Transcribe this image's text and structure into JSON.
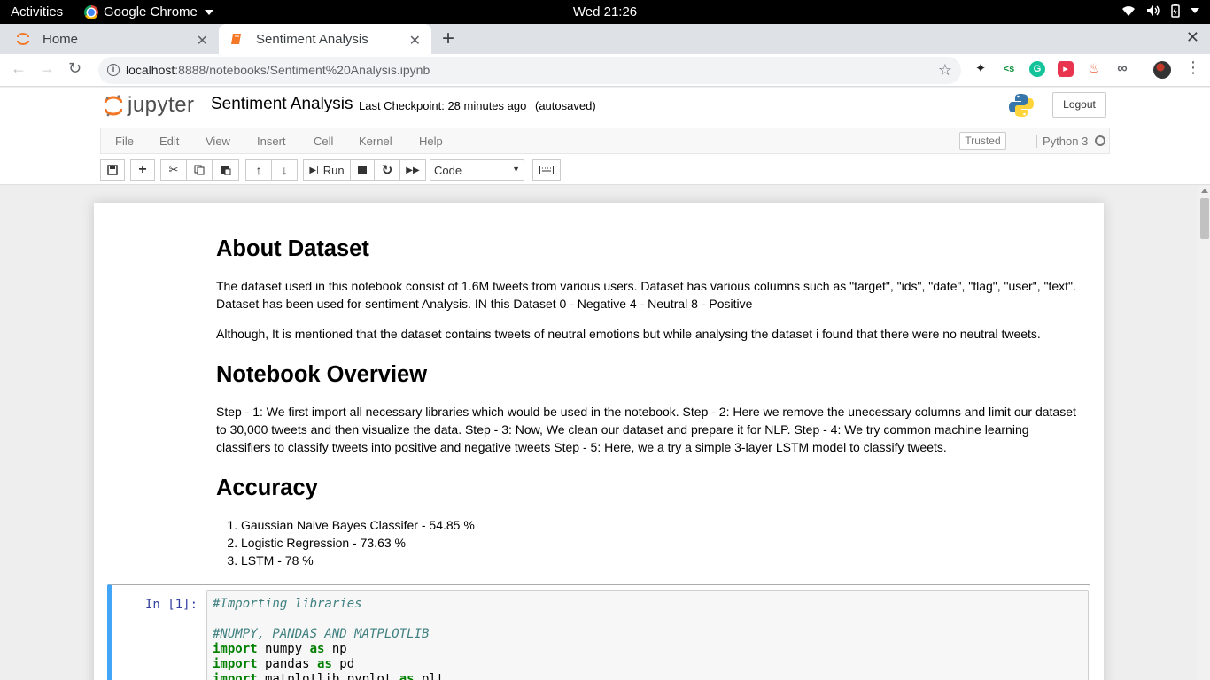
{
  "os": {
    "activities": "Activities",
    "app_name": "Google Chrome",
    "clock": "Wed 21:26"
  },
  "browser": {
    "tabs": [
      {
        "title": "Home",
        "active": false
      },
      {
        "title": "Sentiment Analysis",
        "active": true
      }
    ],
    "url_host": "localhost",
    "url_path": ":8888/notebooks/Sentiment%20Analysis.ipynb"
  },
  "jupyter": {
    "logo_text": "jupyter",
    "notebook_name": "Sentiment Analysis",
    "checkpoint": "Last Checkpoint: 28 minutes ago",
    "autosave": "(autosaved)",
    "logout": "Logout",
    "menu": [
      "File",
      "Edit",
      "View",
      "Insert",
      "Cell",
      "Kernel",
      "Help"
    ],
    "trusted": "Trusted",
    "kernel": "Python 3",
    "toolbar": {
      "run_label": "Run",
      "cell_type": "Code"
    }
  },
  "notebook": {
    "markdown": {
      "h_about": "About Dataset",
      "p_about_1": "The dataset used in this notebook consist of 1.6M tweets from various users. Dataset has various columns such as \"target\", \"ids\", \"date\", \"flag\", \"user\", \"text\". Dataset has been used for sentiment Analysis. IN this Dataset 0 - Negative 4 - Neutral 8 - Positive",
      "p_about_2": "Although, It is mentioned that the dataset contains tweets of neutral emotions but while analysing the dataset i found that there were no neutral tweets.",
      "h_overview": "Notebook Overview",
      "p_overview": "Step - 1: We first import all necessary libraries which would be used in the notebook. Step - 2: Here we remove the unecessary columns and limit our dataset to 30,000 tweets and then visualize the data. Step - 3: Now, We clean our dataset and prepare it for NLP. Step - 4: We try common machine learning classifiers to classify tweets into positive and negative tweets Step - 5: Here, we a try a simple 3-layer LSTM model to classify tweets.",
      "h_accuracy": "Accuracy",
      "accuracy_items": [
        "Gaussian Naive Bayes Classifer - 54.85 %",
        "Logistic Regression - 73.63 %",
        "LSTM - 78 %"
      ]
    },
    "code_cell": {
      "prompt": "In [1]:",
      "comment_1": "#Importing libraries",
      "comment_2": "#NUMPY, PANDAS AND MATPLOTLIB",
      "lines": [
        {
          "kw": "import",
          "mod": " numpy ",
          "as": "as",
          "alias": " np"
        },
        {
          "kw": "import",
          "mod": " pandas ",
          "as": "as",
          "alias": " pd"
        },
        {
          "kw": "import",
          "mod": " matplotlib.pyplot ",
          "as": "as",
          "alias": " plt"
        }
      ]
    }
  }
}
